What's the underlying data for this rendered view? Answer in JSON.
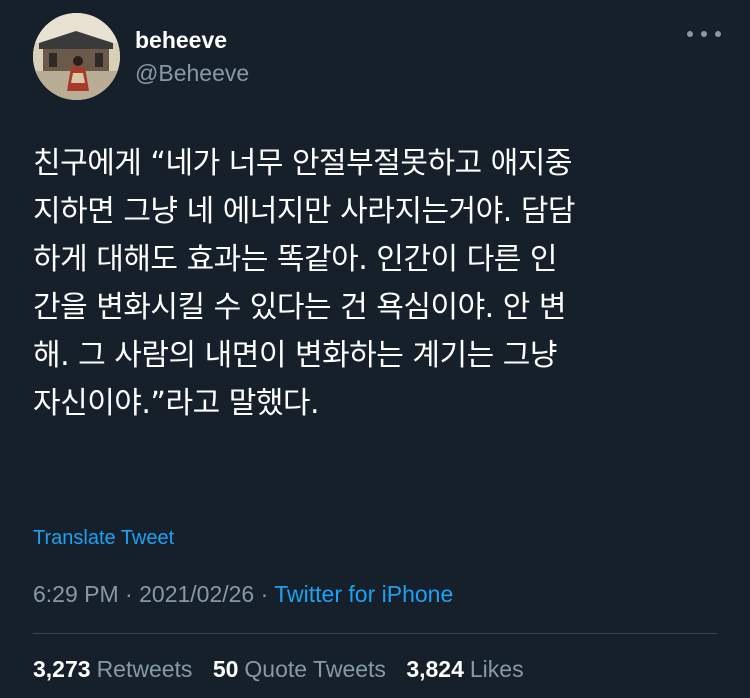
{
  "user": {
    "name": "beheeve",
    "handle": "@Beheeve"
  },
  "tweet": {
    "lines": [
      "친구에게 “네가 너무 안절부절못하고 애지중",
      "지하면 그냥 네 에너지만 사라지는거야. 담담",
      "하게 대해도 효과는 똑같아. 인간이 다른 인",
      "간을 변화시킬 수 있다는 건 욕심이야. 안 변",
      "해. 그 사람의 내면이 변화하는 계기는 그냥",
      "자신이야.”라고 말했다."
    ],
    "translate_label": "Translate Tweet"
  },
  "meta": {
    "time": "6:29 PM",
    "date": "2021/02/26",
    "separator": "·",
    "source": "Twitter for iPhone"
  },
  "stats": {
    "retweets": {
      "count": "3,273",
      "label": "Retweets"
    },
    "quotes": {
      "count": "50",
      "label": "Quote Tweets"
    },
    "likes": {
      "count": "3,824",
      "label": "Likes"
    }
  },
  "colors": {
    "background": "#15202b",
    "accent": "#1da1f2",
    "secondary_text": "#8899a6",
    "divider": "#38444d"
  },
  "icons": {
    "more": "more-dots-icon"
  }
}
